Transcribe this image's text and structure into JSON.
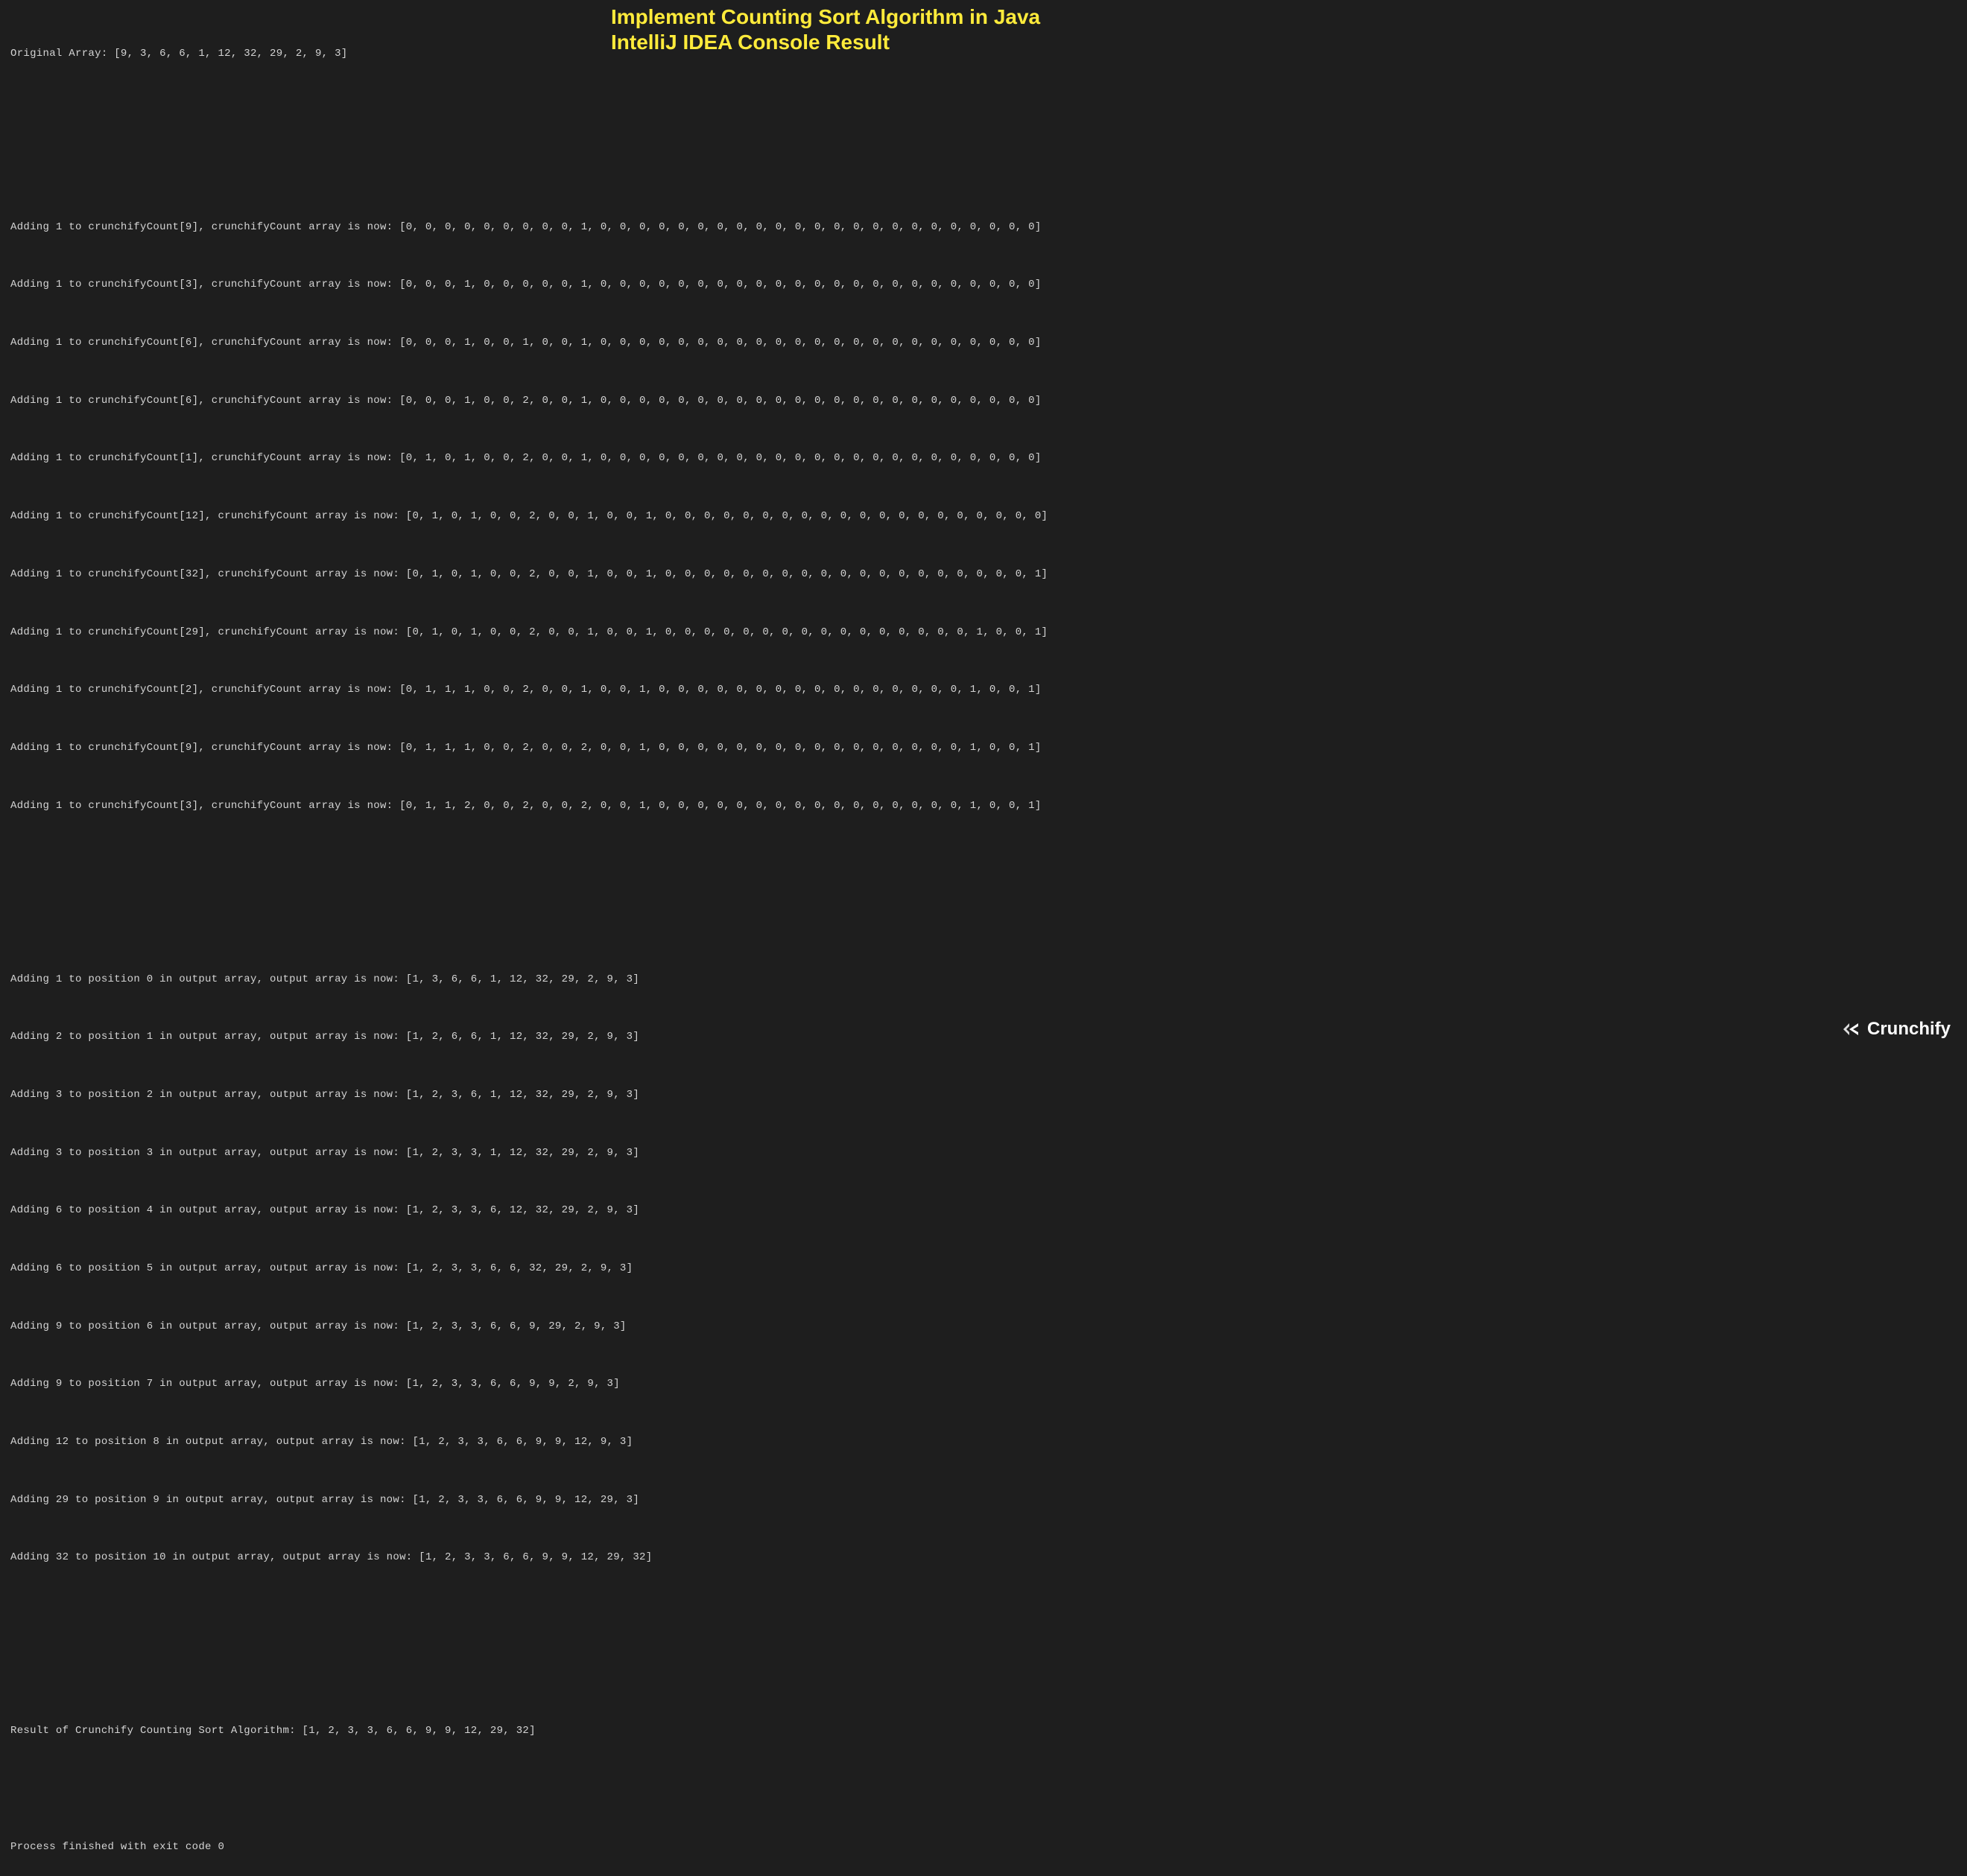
{
  "title": {
    "line1": "Implement Counting Sort Algorithm in Java",
    "line2": "IntelliJ IDEA Console Result"
  },
  "logo": {
    "text": "Crunchify"
  },
  "console": {
    "original": "Original Array: [9, 3, 6, 6, 1, 12, 32, 29, 2, 9, 3]",
    "countLines": [
      "Adding 1 to crunchifyCount[9], crunchifyCount array is now: [0, 0, 0, 0, 0, 0, 0, 0, 0, 1, 0, 0, 0, 0, 0, 0, 0, 0, 0, 0, 0, 0, 0, 0, 0, 0, 0, 0, 0, 0, 0, 0, 0]",
      "Adding 1 to crunchifyCount[3], crunchifyCount array is now: [0, 0, 0, 1, 0, 0, 0, 0, 0, 1, 0, 0, 0, 0, 0, 0, 0, 0, 0, 0, 0, 0, 0, 0, 0, 0, 0, 0, 0, 0, 0, 0, 0]",
      "Adding 1 to crunchifyCount[6], crunchifyCount array is now: [0, 0, 0, 1, 0, 0, 1, 0, 0, 1, 0, 0, 0, 0, 0, 0, 0, 0, 0, 0, 0, 0, 0, 0, 0, 0, 0, 0, 0, 0, 0, 0, 0]",
      "Adding 1 to crunchifyCount[6], crunchifyCount array is now: [0, 0, 0, 1, 0, 0, 2, 0, 0, 1, 0, 0, 0, 0, 0, 0, 0, 0, 0, 0, 0, 0, 0, 0, 0, 0, 0, 0, 0, 0, 0, 0, 0]",
      "Adding 1 to crunchifyCount[1], crunchifyCount array is now: [0, 1, 0, 1, 0, 0, 2, 0, 0, 1, 0, 0, 0, 0, 0, 0, 0, 0, 0, 0, 0, 0, 0, 0, 0, 0, 0, 0, 0, 0, 0, 0, 0]",
      "Adding 1 to crunchifyCount[12], crunchifyCount array is now: [0, 1, 0, 1, 0, 0, 2, 0, 0, 1, 0, 0, 1, 0, 0, 0, 0, 0, 0, 0, 0, 0, 0, 0, 0, 0, 0, 0, 0, 0, 0, 0, 0]",
      "Adding 1 to crunchifyCount[32], crunchifyCount array is now: [0, 1, 0, 1, 0, 0, 2, 0, 0, 1, 0, 0, 1, 0, 0, 0, 0, 0, 0, 0, 0, 0, 0, 0, 0, 0, 0, 0, 0, 0, 0, 0, 1]",
      "Adding 1 to crunchifyCount[29], crunchifyCount array is now: [0, 1, 0, 1, 0, 0, 2, 0, 0, 1, 0, 0, 1, 0, 0, 0, 0, 0, 0, 0, 0, 0, 0, 0, 0, 0, 0, 0, 0, 1, 0, 0, 1]",
      "Adding 1 to crunchifyCount[2], crunchifyCount array is now: [0, 1, 1, 1, 0, 0, 2, 0, 0, 1, 0, 0, 1, 0, 0, 0, 0, 0, 0, 0, 0, 0, 0, 0, 0, 0, 0, 0, 0, 1, 0, 0, 1]",
      "Adding 1 to crunchifyCount[9], crunchifyCount array is now: [0, 1, 1, 1, 0, 0, 2, 0, 0, 2, 0, 0, 1, 0, 0, 0, 0, 0, 0, 0, 0, 0, 0, 0, 0, 0, 0, 0, 0, 1, 0, 0, 1]",
      "Adding 1 to crunchifyCount[3], crunchifyCount array is now: [0, 1, 1, 2, 0, 0, 2, 0, 0, 2, 0, 0, 1, 0, 0, 0, 0, 0, 0, 0, 0, 0, 0, 0, 0, 0, 0, 0, 0, 1, 0, 0, 1]"
    ],
    "outputLines": [
      "Adding 1 to position 0 in output array, output array is now: [1, 3, 6, 6, 1, 12, 32, 29, 2, 9, 3]",
      "Adding 2 to position 1 in output array, output array is now: [1, 2, 6, 6, 1, 12, 32, 29, 2, 9, 3]",
      "Adding 3 to position 2 in output array, output array is now: [1, 2, 3, 6, 1, 12, 32, 29, 2, 9, 3]",
      "Adding 3 to position 3 in output array, output array is now: [1, 2, 3, 3, 1, 12, 32, 29, 2, 9, 3]",
      "Adding 6 to position 4 in output array, output array is now: [1, 2, 3, 3, 6, 12, 32, 29, 2, 9, 3]",
      "Adding 6 to position 5 in output array, output array is now: [1, 2, 3, 3, 6, 6, 32, 29, 2, 9, 3]",
      "Adding 9 to position 6 in output array, output array is now: [1, 2, 3, 3, 6, 6, 9, 29, 2, 9, 3]",
      "Adding 9 to position 7 in output array, output array is now: [1, 2, 3, 3, 6, 6, 9, 9, 2, 9, 3]",
      "Adding 12 to position 8 in output array, output array is now: [1, 2, 3, 3, 6, 6, 9, 9, 12, 9, 3]",
      "Adding 29 to position 9 in output array, output array is now: [1, 2, 3, 3, 6, 6, 9, 9, 12, 29, 3]",
      "Adding 32 to position 10 in output array, output array is now: [1, 2, 3, 3, 6, 6, 9, 9, 12, 29, 32]"
    ],
    "result": "Result of Crunchify Counting Sort Algorithm: [1, 2, 3, 3, 6, 6, 9, 9, 12, 29, 32]",
    "exit": "Process finished with exit code 0"
  }
}
